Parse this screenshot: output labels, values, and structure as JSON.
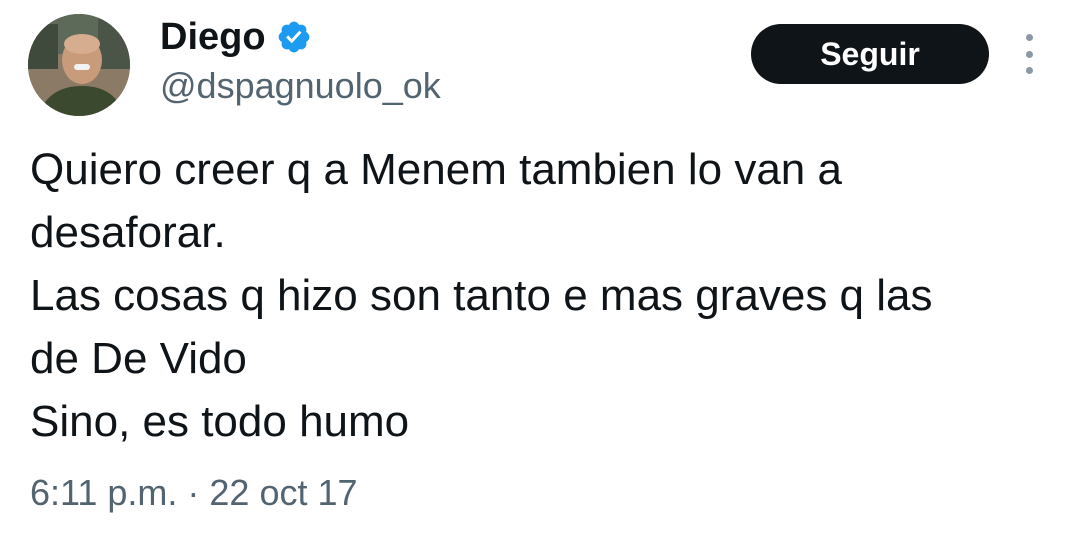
{
  "author": {
    "display_name": "Diego",
    "handle": "@dspagnuolo_ok",
    "verified_icon": "verified-badge-icon",
    "verified_color": "#1d9bf0"
  },
  "actions": {
    "follow_label": "Seguir",
    "more_icon": "more-options-icon"
  },
  "tweet": {
    "lines": [
      "Quiero creer q a Menem tambien lo van a",
      "desaforar.",
      "Las cosas q hizo son tanto e mas graves q las",
      "de De Vido",
      "Sino, es todo humo"
    ],
    "timestamp": "6:11 p.m. · 22 oct 17"
  }
}
